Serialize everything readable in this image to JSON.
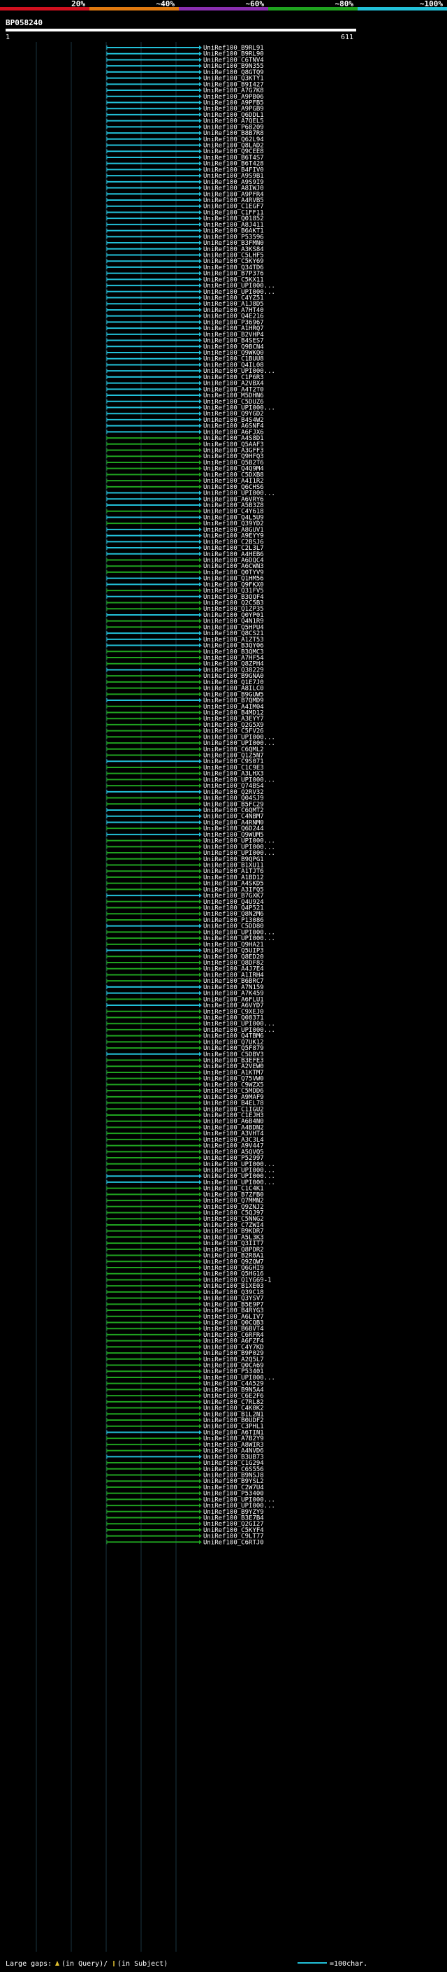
{
  "chart_data": {
    "type": "alignment-overview",
    "query_id": "BP058240",
    "start_label": "1",
    "end_label": "611",
    "scale_labels": [
      "20%",
      "~40%",
      "~60%",
      "~80%",
      "~100%"
    ],
    "identity_colors": {
      "band1": "#d0101e",
      "band2": "#e07a10",
      "band3": "#8a2fb0",
      "band4": "#1fa31f",
      "band5": "#22c0d8"
    },
    "legend": {
      "gaps_text": "Large gaps:",
      "query_text": "(in Query)/",
      "subject_text": "(in Subject)",
      "scale_text": "=100char."
    },
    "hits": [
      {
        "label": "UniRef100_B9RL91",
        "band": "band5"
      },
      {
        "label": "UniRef100_B9RL90",
        "band": "band5"
      },
      {
        "label": "UniRef100_C6TNV4",
        "band": "band5"
      },
      {
        "label": "UniRef100_B9N355",
        "band": "band5"
      },
      {
        "label": "UniRef100_Q8GTQ9",
        "band": "band5"
      },
      {
        "label": "UniRef100_Q3KTY1",
        "band": "band5"
      },
      {
        "label": "UniRef100_B9I427",
        "band": "band5"
      },
      {
        "label": "UniRef100_A7G7K8",
        "band": "band5"
      },
      {
        "label": "UniRef100_A9PB06",
        "band": "band5"
      },
      {
        "label": "UniRef100_A9PFB5",
        "band": "band5"
      },
      {
        "label": "UniRef100_A9PGB9",
        "band": "band5"
      },
      {
        "label": "UniRef100_Q6DDL1",
        "band": "band5"
      },
      {
        "label": "UniRef100_A7QEL5",
        "band": "band5"
      },
      {
        "label": "UniRef100_P68209",
        "band": "band5"
      },
      {
        "label": "UniRef100_B8B7R8",
        "band": "band5"
      },
      {
        "label": "UniRef100_Q62L94",
        "band": "band5"
      },
      {
        "label": "UniRef100_Q8LAD2",
        "band": "band5"
      },
      {
        "label": "UniRef100_Q9CEE8",
        "band": "band5"
      },
      {
        "label": "UniRef100_B6T4S7",
        "band": "band5"
      },
      {
        "label": "UniRef100_B6T428",
        "band": "band5"
      },
      {
        "label": "UniRef100_B4FIV0",
        "band": "band5"
      },
      {
        "label": "UniRef100_A9S9B1",
        "band": "band5"
      },
      {
        "label": "UniRef100_A9S9I9",
        "band": "band5"
      },
      {
        "label": "UniRef100_A8IWJ0",
        "band": "band5"
      },
      {
        "label": "UniRef100_A9PFR4",
        "band": "band5"
      },
      {
        "label": "UniRef100_A4RVB5",
        "band": "band5"
      },
      {
        "label": "UniRef100_C1EGF7",
        "band": "band5"
      },
      {
        "label": "UniRef100_C1FF11",
        "band": "band5"
      },
      {
        "label": "UniRef100_Q01852",
        "band": "band5"
      },
      {
        "label": "UniRef100_A8J411",
        "band": "band5"
      },
      {
        "label": "UniRef100_B6AKT1",
        "band": "band5"
      },
      {
        "label": "UniRef100_P53596",
        "band": "band5"
      },
      {
        "label": "UniRef100_B3FMN0",
        "band": "band5"
      },
      {
        "label": "UniRef100_A3KS84",
        "band": "band5"
      },
      {
        "label": "UniRef100_C5LHF5",
        "band": "band5"
      },
      {
        "label": "UniRef100_C5KY69",
        "band": "band5"
      },
      {
        "label": "UniRef100_Q34TD6",
        "band": "band5"
      },
      {
        "label": "UniRef100_B7P376",
        "band": "band5"
      },
      {
        "label": "UniRef100_C5KX11",
        "band": "band5"
      },
      {
        "label": "UniRef100_UPI000...",
        "band": "band5"
      },
      {
        "label": "UniRef100_UPI000...",
        "band": "band5"
      },
      {
        "label": "UniRef100_C4YZ51",
        "band": "band5"
      },
      {
        "label": "UniRef100_A1J8D5",
        "band": "band5"
      },
      {
        "label": "UniRef100_A7HT40",
        "band": "band5"
      },
      {
        "label": "UniRef100_Q4E216",
        "band": "band5"
      },
      {
        "label": "UniRef100_P36967",
        "band": "band5"
      },
      {
        "label": "UniRef100_A1HRQ7",
        "band": "band5"
      },
      {
        "label": "UniRef100_B2VHP4",
        "band": "band5"
      },
      {
        "label": "UniRef100_B4SES7",
        "band": "band5"
      },
      {
        "label": "UniRef100_Q9BCN4",
        "band": "band5"
      },
      {
        "label": "UniRef100_Q9WKQ0",
        "band": "band5"
      },
      {
        "label": "UniRef100_C1BUU8",
        "band": "band5"
      },
      {
        "label": "UniRef100_Q4IL08",
        "band": "band5"
      },
      {
        "label": "UniRef100_UPI000...",
        "band": "band5"
      },
      {
        "label": "UniRef100_C1P6R3",
        "band": "band5"
      },
      {
        "label": "UniRef100_A2VBX4",
        "band": "band5"
      },
      {
        "label": "UniRef100_A4T2T0",
        "band": "band5"
      },
      {
        "label": "UniRef100_M5DHN6",
        "band": "band5"
      },
      {
        "label": "UniRef100_C5DUZ6",
        "band": "band5"
      },
      {
        "label": "UniRef100_UPI000...",
        "band": "band5"
      },
      {
        "label": "UniRef100_Q9YGD2",
        "band": "band5"
      },
      {
        "label": "UniRef100_B4S4W2",
        "band": "band5"
      },
      {
        "label": "UniRef100_A6SNF4",
        "band": "band5"
      },
      {
        "label": "UniRef100_A6FJX6",
        "band": "band5"
      },
      {
        "label": "UniRef100_A4S8D1",
        "band": "band4"
      },
      {
        "label": "UniRef100_Q5AAF3",
        "band": "band4"
      },
      {
        "label": "UniRef100_A3GFF3",
        "band": "band4"
      },
      {
        "label": "UniRef100_Q9HFQ3",
        "band": "band4"
      },
      {
        "label": "UniRef100_Q5B2T6",
        "band": "band4"
      },
      {
        "label": "UniRef100_Q4Q9M4",
        "band": "band4"
      },
      {
        "label": "UniRef100_C5DXB8",
        "band": "band4"
      },
      {
        "label": "UniRef100_A4I1R2",
        "band": "band4"
      },
      {
        "label": "UniRef100_Q6CHS6",
        "band": "band4"
      },
      {
        "label": "UniRef100_UPI000...",
        "band": "band5"
      },
      {
        "label": "UniRef100_A6VRY6",
        "band": "band5"
      },
      {
        "label": "UniRef100_A5B3Z8",
        "band": "band5"
      },
      {
        "label": "UniRef100_C4Y618",
        "band": "band4"
      },
      {
        "label": "UniRef100_Q4L5U9",
        "band": "band5"
      },
      {
        "label": "UniRef100_Q39YD2",
        "band": "band4"
      },
      {
        "label": "UniRef100_A8GUV1",
        "band": "band5"
      },
      {
        "label": "UniRef100_A9EYY9",
        "band": "band5"
      },
      {
        "label": "UniRef100_C2BSJ6",
        "band": "band5"
      },
      {
        "label": "UniRef100_C2L3L7",
        "band": "band5"
      },
      {
        "label": "UniRef100_A4HEB6",
        "band": "band5"
      },
      {
        "label": "UniRef100_A6DQC4",
        "band": "band4"
      },
      {
        "label": "UniRef100_A6CWN3",
        "band": "band4"
      },
      {
        "label": "UniRef100_Q0TYV9",
        "band": "band4"
      },
      {
        "label": "UniRef100_Q1HM56",
        "band": "band5"
      },
      {
        "label": "UniRef100_Q9FKX0",
        "band": "band5"
      },
      {
        "label": "UniRef100_Q31FV5",
        "band": "band4"
      },
      {
        "label": "UniRef100_B3QQF4",
        "band": "band5"
      },
      {
        "label": "UniRef100_Q2C5B3",
        "band": "band4"
      },
      {
        "label": "UniRef100_Q1ZP35",
        "band": "band4"
      },
      {
        "label": "UniRef100_Q0YP01",
        "band": "band5"
      },
      {
        "label": "UniRef100_Q4N1R9",
        "band": "band4"
      },
      {
        "label": "UniRef100_Q5HPU4",
        "band": "band4"
      },
      {
        "label": "UniRef100_Q8CS21",
        "band": "band5"
      },
      {
        "label": "UniRef100_A1ZT53",
        "band": "band5"
      },
      {
        "label": "UniRef100_B3QY06",
        "band": "band5"
      },
      {
        "label": "UniRef100_B3QMC3",
        "band": "band4"
      },
      {
        "label": "UniRef100_A7HF54",
        "band": "band4"
      },
      {
        "label": "UniRef100_Q8ZPH4",
        "band": "band4"
      },
      {
        "label": "UniRef100_Q38229",
        "band": "band5"
      },
      {
        "label": "UniRef100_B9GNA0",
        "band": "band4"
      },
      {
        "label": "UniRef100_Q1E7J0",
        "band": "band4"
      },
      {
        "label": "UniRef100_A8ILC0",
        "band": "band4"
      },
      {
        "label": "UniRef100_B9GUW5",
        "band": "band4"
      },
      {
        "label": "UniRef100_B7QMD9",
        "band": "band5"
      },
      {
        "label": "UniRef100_A4IM04",
        "band": "band4"
      },
      {
        "label": "UniRef100_B4MD12",
        "band": "band4"
      },
      {
        "label": "UniRef100_A3EYY7",
        "band": "band4"
      },
      {
        "label": "UniRef100_Q2G5X9",
        "band": "band4"
      },
      {
        "label": "UniRef100_C5FV26",
        "band": "band4"
      },
      {
        "label": "UniRef100_UPI000...",
        "band": "band4"
      },
      {
        "label": "UniRef100_UPI000...",
        "band": "band4"
      },
      {
        "label": "UniRef100_C6QML2",
        "band": "band4"
      },
      {
        "label": "UniRef100_Q1Z5N7",
        "band": "band4"
      },
      {
        "label": "UniRef100_C9S071",
        "band": "band5"
      },
      {
        "label": "UniRef100_C1C9E3",
        "band": "band4"
      },
      {
        "label": "UniRef100_A3LHX3",
        "band": "band4"
      },
      {
        "label": "UniRef100_UPI000...",
        "band": "band4"
      },
      {
        "label": "UniRef100_Q74BS4",
        "band": "band4"
      },
      {
        "label": "UniRef100_Q2RV32",
        "band": "band5"
      },
      {
        "label": "UniRef100_Q04SJ9",
        "band": "band4"
      },
      {
        "label": "UniRef100_B5FC29",
        "band": "band4"
      },
      {
        "label": "UniRef100_C6QMT2",
        "band": "band5"
      },
      {
        "label": "UniRef100_C4NBM7",
        "band": "band5"
      },
      {
        "label": "UniRef100_A4RNM0",
        "band": "band5"
      },
      {
        "label": "UniRef100_Q6D244",
        "band": "band4"
      },
      {
        "label": "UniRef100_Q9WUM5",
        "band": "band5"
      },
      {
        "label": "UniRef100_UPI000...",
        "band": "band4"
      },
      {
        "label": "UniRef100_UPI000...",
        "band": "band4"
      },
      {
        "label": "UniRef100_UPI000...",
        "band": "band4"
      },
      {
        "label": "UniRef100_B9QPG1",
        "band": "band4"
      },
      {
        "label": "UniRef100_B1XU11",
        "band": "band4"
      },
      {
        "label": "UniRef100_A1TJT6",
        "band": "band4"
      },
      {
        "label": "UniRef100_A1BD12",
        "band": "band4"
      },
      {
        "label": "UniRef100_A4SKD5",
        "band": "band4"
      },
      {
        "label": "UniRef100_A3IFQ5",
        "band": "band4"
      },
      {
        "label": "UniRef100_B7GXK7",
        "band": "band5"
      },
      {
        "label": "UniRef100_Q4U924",
        "band": "band4"
      },
      {
        "label": "UniRef100_Q4P521",
        "band": "band4"
      },
      {
        "label": "UniRef100_Q8N2M6",
        "band": "band4"
      },
      {
        "label": "UniRef100_P13086",
        "band": "band4"
      },
      {
        "label": "UniRef100_C5DD80",
        "band": "band5"
      },
      {
        "label": "UniRef100_UPI000...",
        "band": "band4"
      },
      {
        "label": "UniRef100_UPI000...",
        "band": "band4"
      },
      {
        "label": "UniRef100_Q9HA21",
        "band": "band4"
      },
      {
        "label": "UniRef100_Q5UIP3",
        "band": "band5"
      },
      {
        "label": "UniRef100_Q8ED20",
        "band": "band4"
      },
      {
        "label": "UniRef100_Q8DF82",
        "band": "band4"
      },
      {
        "label": "UniRef100_A4J7E4",
        "band": "band4"
      },
      {
        "label": "UniRef100_A1IRH4",
        "band": "band4"
      },
      {
        "label": "UniRef100_B6BRC7",
        "band": "band4"
      },
      {
        "label": "UniRef100_A7N159",
        "band": "band5"
      },
      {
        "label": "UniRef100_A7K459",
        "band": "band5"
      },
      {
        "label": "UniRef100_A6FLU1",
        "band": "band4"
      },
      {
        "label": "UniRef100_A6VYD7",
        "band": "band5"
      },
      {
        "label": "UniRef100_C9XEJ0",
        "band": "band4"
      },
      {
        "label": "UniRef100_Q08371",
        "band": "band4"
      },
      {
        "label": "UniRef100_UPI000...",
        "band": "band4"
      },
      {
        "label": "UniRef100_UPI000...",
        "band": "band4"
      },
      {
        "label": "UniRef100_Q4TBM6",
        "band": "band4"
      },
      {
        "label": "UniRef100_Q7UK12",
        "band": "band4"
      },
      {
        "label": "UniRef100_Q5F879",
        "band": "band4"
      },
      {
        "label": "UniRef100_C5DBV3",
        "band": "band5"
      },
      {
        "label": "UniRef100_B3EFE3",
        "band": "band4"
      },
      {
        "label": "UniRef100_A2VEW0",
        "band": "band4"
      },
      {
        "label": "UniRef100_A1KTM7",
        "band": "band4"
      },
      {
        "label": "UniRef100_Q75VW0",
        "band": "band4"
      },
      {
        "label": "UniRef100_C9WZX5",
        "band": "band4"
      },
      {
        "label": "UniRef100_C5MDD6",
        "band": "band4"
      },
      {
        "label": "UniRef100_A9MAF9",
        "band": "band4"
      },
      {
        "label": "UniRef100_B4EL78",
        "band": "band4"
      },
      {
        "label": "UniRef100_C1IGU2",
        "band": "band4"
      },
      {
        "label": "UniRef100_C1EJH3",
        "band": "band4"
      },
      {
        "label": "UniRef100_A6B4N0",
        "band": "band4"
      },
      {
        "label": "UniRef100_A4BDN2",
        "band": "band4"
      },
      {
        "label": "UniRef100_A3VHT4",
        "band": "band4"
      },
      {
        "label": "UniRef100_A3C3L4",
        "band": "band4"
      },
      {
        "label": "UniRef100_A9V447",
        "band": "band4"
      },
      {
        "label": "UniRef100_A5QVQ5",
        "band": "band4"
      },
      {
        "label": "UniRef100_P52997",
        "band": "band4"
      },
      {
        "label": "UniRef100_UPI000...",
        "band": "band4"
      },
      {
        "label": "UniRef100_UPI000...",
        "band": "band4"
      },
      {
        "label": "UniRef100_UPI000...",
        "band": "band5"
      },
      {
        "label": "UniRef100_UPI000...",
        "band": "band5"
      },
      {
        "label": "UniRef100_C1C4K1",
        "band": "band4"
      },
      {
        "label": "UniRef100_B7ZFB0",
        "band": "band4"
      },
      {
        "label": "UniRef100_Q7MMN2",
        "band": "band4"
      },
      {
        "label": "UniRef100_Q9ZNJ2",
        "band": "band4"
      },
      {
        "label": "UniRef100_C5QJ97",
        "band": "band4"
      },
      {
        "label": "UniRef100_C5NNG2",
        "band": "band4"
      },
      {
        "label": "UniRef100_C7ZWI4",
        "band": "band4"
      },
      {
        "label": "UniRef100_B9KDR7",
        "band": "band4"
      },
      {
        "label": "UniRef100_A5L3K3",
        "band": "band4"
      },
      {
        "label": "UniRef100_Q3IIT7",
        "band": "band4"
      },
      {
        "label": "UniRef100_Q8PDR2",
        "band": "band4"
      },
      {
        "label": "UniRef100_B2R8A1",
        "band": "band4"
      },
      {
        "label": "UniRef100_Q9ZQW7",
        "band": "band4"
      },
      {
        "label": "UniRef100_Q6GHI9",
        "band": "band4"
      },
      {
        "label": "UniRef100_Q5HG16",
        "band": "band4"
      },
      {
        "label": "UniRef100_Q1YG69-1",
        "band": "band4"
      },
      {
        "label": "UniRef100_B1XE03",
        "band": "band4"
      },
      {
        "label": "UniRef100_Q39C18",
        "band": "band4"
      },
      {
        "label": "UniRef100_Q3YSV7",
        "band": "band4"
      },
      {
        "label": "UniRef100_B5E9P7",
        "band": "band4"
      },
      {
        "label": "UniRef100_B4RYG3",
        "band": "band4"
      },
      {
        "label": "UniRef100_A6LIV7",
        "band": "band4"
      },
      {
        "label": "UniRef100_Q0CQB3",
        "band": "band4"
      },
      {
        "label": "UniRef100_B6BVT4",
        "band": "band4"
      },
      {
        "label": "UniRef100_C6RFR4",
        "band": "band4"
      },
      {
        "label": "UniRef100_A6FZF4",
        "band": "band4"
      },
      {
        "label": "UniRef100_C4Y7KD",
        "band": "band4"
      },
      {
        "label": "UniRef100_B9P029",
        "band": "band4"
      },
      {
        "label": "UniRef100_A2Q5L7",
        "band": "band4"
      },
      {
        "label": "UniRef100_Q0CA69",
        "band": "band4"
      },
      {
        "label": "UniRef100_P53401",
        "band": "band4"
      },
      {
        "label": "UniRef100_UPI000...",
        "band": "band4"
      },
      {
        "label": "UniRef100_C4A529",
        "band": "band4"
      },
      {
        "label": "UniRef100_B9N5A4",
        "band": "band4"
      },
      {
        "label": "UniRef100_C6E2F6",
        "band": "band4"
      },
      {
        "label": "UniRef100_C7RL82",
        "band": "band4"
      },
      {
        "label": "UniRef100_C4K0K2",
        "band": "band4"
      },
      {
        "label": "UniRef100_B1L2N1",
        "band": "band4"
      },
      {
        "label": "UniRef100_B0UDF2",
        "band": "band4"
      },
      {
        "label": "UniRef100_C3PHL1",
        "band": "band4"
      },
      {
        "label": "UniRef100_A6TIN1",
        "band": "band5"
      },
      {
        "label": "UniRef100_A7B2Y9",
        "band": "band4"
      },
      {
        "label": "UniRef100_A8WIR3",
        "band": "band4"
      },
      {
        "label": "UniRef100_A4NVD6",
        "band": "band4"
      },
      {
        "label": "UniRef100_B3UB73",
        "band": "band5"
      },
      {
        "label": "UniRef100_C1G294",
        "band": "band4"
      },
      {
        "label": "UniRef100_C6S556",
        "band": "band4"
      },
      {
        "label": "UniRef100_B9NSJ8",
        "band": "band4"
      },
      {
        "label": "UniRef100_B9YSL2",
        "band": "band4"
      },
      {
        "label": "UniRef100_C2W7U4",
        "band": "band4"
      },
      {
        "label": "UniRef100_P53400",
        "band": "band4"
      },
      {
        "label": "UniRef100_UPI000...",
        "band": "band4"
      },
      {
        "label": "UniRef100_UPI000...",
        "band": "band4"
      },
      {
        "label": "UniRef100_B9YZY9",
        "band": "band4"
      },
      {
        "label": "UniRef100_B3E7B4",
        "band": "band4"
      },
      {
        "label": "UniRef100_Q2GI27",
        "band": "band4"
      },
      {
        "label": "UniRef100_C5KYF4",
        "band": "band4"
      },
      {
        "label": "UniRef100_C9LT77",
        "band": "band4"
      },
      {
        "label": "UniRef100_C6RTJ0",
        "band": "band4"
      }
    ]
  }
}
